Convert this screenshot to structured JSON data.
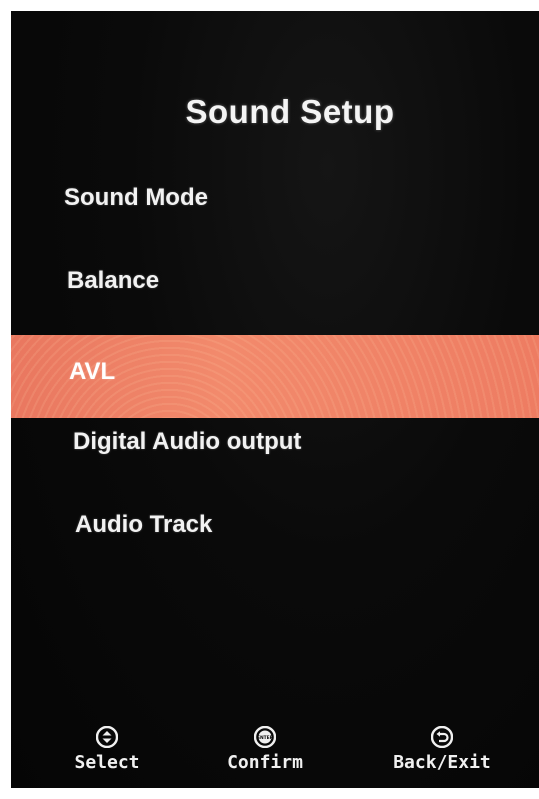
{
  "menu": {
    "title": "Sound Setup",
    "items": [
      {
        "label": "Sound Mode"
      },
      {
        "label": "Balance"
      },
      {
        "label": "AVL",
        "selected": true
      },
      {
        "label": "Digital Audio output"
      },
      {
        "label": "Audio Track"
      }
    ],
    "accent_color": "#ef7f64"
  },
  "footer": {
    "select": {
      "label": "Select",
      "icon": "up-down-arrows-icon"
    },
    "confirm": {
      "label": "Confirm",
      "icon": "enter-icon",
      "icon_text": "ENTER"
    },
    "back": {
      "label": "Back/Exit",
      "icon": "back-arrow-icon"
    }
  }
}
